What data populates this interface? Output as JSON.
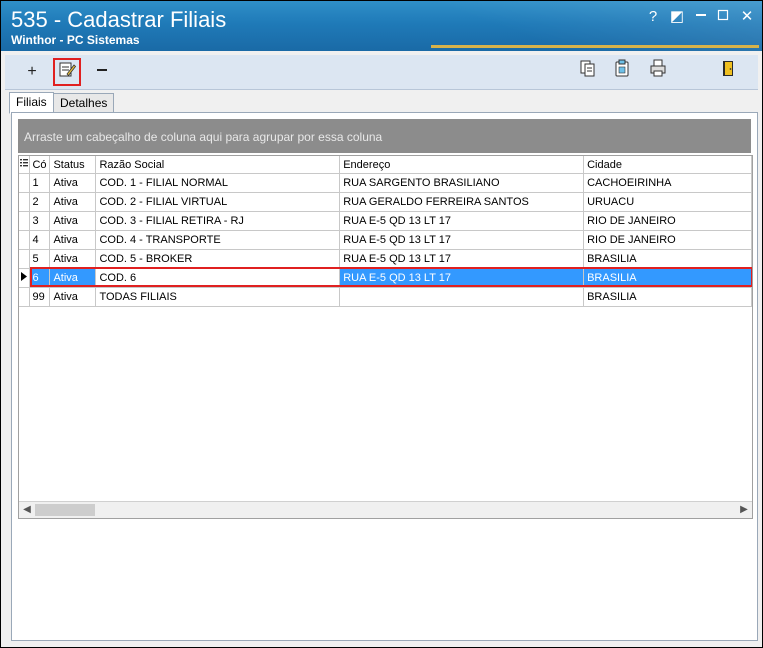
{
  "window": {
    "title": "535 - Cadastrar Filiais",
    "subtitle": "Winthor - PC Sistemas",
    "controls": {
      "help": "?",
      "restore": "◩",
      "minimize": "—",
      "close": "✕"
    }
  },
  "toolbar": {
    "add": "+",
    "edit": "✎",
    "remove": "—",
    "copy": "⧉",
    "clipboard": "📋",
    "print": "🖶",
    "exit": "🚪"
  },
  "tabs": [
    {
      "label": "Filiais"
    },
    {
      "label": "Detalhes"
    }
  ],
  "grid": {
    "group_hint": "Arraste um cabeçalho de coluna aqui para agrupar por essa coluna",
    "columns": [
      "Có",
      "Status",
      "Razão Social",
      "Endereço",
      "Cidade"
    ],
    "rows": [
      {
        "cod": "1",
        "status": "Ativa",
        "razao": "COD. 1 - FILIAL NORMAL",
        "endereco": "RUA SARGENTO BRASILIANO",
        "cidade": "CACHOEIRINHA"
      },
      {
        "cod": "2",
        "status": "Ativa",
        "razao": "COD. 2 - FILIAL VIRTUAL",
        "endereco": "RUA GERALDO FERREIRA SANTOS",
        "cidade": "URUACU"
      },
      {
        "cod": "3",
        "status": "Ativa",
        "razao": "COD. 3 - FILIAL RETIRA - RJ",
        "endereco": "RUA E-5 QD 13 LT 17",
        "cidade": "RIO DE JANEIRO"
      },
      {
        "cod": "4",
        "status": "Ativa",
        "razao": "COD. 4 - TRANSPORTE",
        "endereco": "RUA E-5 QD 13 LT 17",
        "cidade": "RIO DE JANEIRO"
      },
      {
        "cod": "5",
        "status": "Ativa",
        "razao": "COD. 5 - BROKER",
        "endereco": "RUA E-5 QD 13 LT 17",
        "cidade": "BRASILIA"
      },
      {
        "cod": "6",
        "status": "Ativa",
        "razao": "COD. 6",
        "endereco": "RUA E-5 QD 13 LT 17",
        "cidade": "BRASILIA"
      },
      {
        "cod": "99",
        "status": "Ativa",
        "razao": "TODAS FILIAIS",
        "endereco": "",
        "cidade": "BRASILIA"
      }
    ]
  },
  "colors": {
    "title_bar": "#1f7ab8",
    "selection": "#3399ff",
    "highlight": "#e02020"
  }
}
